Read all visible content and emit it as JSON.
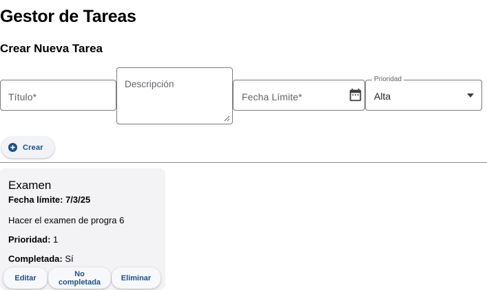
{
  "header": {
    "title": "Gestor de Tareas"
  },
  "form": {
    "section_title": "Crear Nueva Tarea",
    "title_placeholder": "Título*",
    "description_placeholder": "Descripción",
    "date_placeholder": "Fecha Límite*",
    "priority_label": "Prioridad",
    "priority_value": "Alta",
    "priority_options_visible": [
      "Alta"
    ],
    "create_label": "Crear",
    "icons": {
      "date": "calendar-icon",
      "priority": "chevron-down-icon",
      "create": "plus-circle-icon"
    }
  },
  "tasks": [
    {
      "title": "Examen",
      "due_date": "Fecha límite: 7/3/25",
      "description": "Hacer el examen de progra 6",
      "priority_label": "Prioridad:",
      "priority_value": "1",
      "completed_label": "Completada:",
      "completed_value": "Sí",
      "actions": {
        "edit": "Editar",
        "not_completed_line1": "No",
        "not_completed_line2": "completada",
        "delete": "Eliminar"
      }
    }
  ],
  "colors": {
    "accent": "#1a4f8a",
    "card_bg": "#f3f3f6",
    "border": "#7a7a7a"
  }
}
